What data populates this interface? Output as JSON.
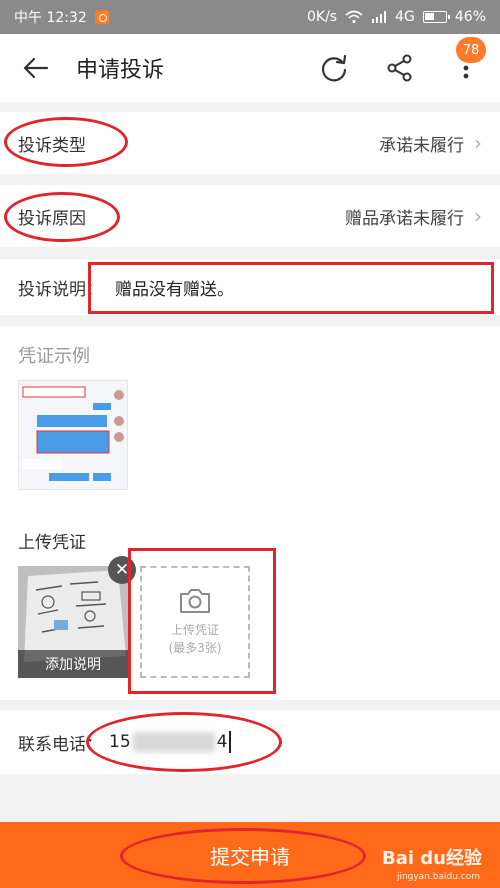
{
  "status_bar": {
    "time": "中午 12:32",
    "net": "0K/s",
    "signal": "4G",
    "battery": "46%"
  },
  "header": {
    "title": "申请投诉",
    "badge": "78"
  },
  "icons": {
    "back": "arrow-left-icon",
    "refresh": "refresh-icon",
    "share": "share-icon",
    "more": "more-vertical-icon",
    "camera": "camera-icon",
    "close": "close-icon",
    "chevron": "chevron-right-icon"
  },
  "complaint_type": {
    "label": "投诉类型",
    "value": "承诺未履行"
  },
  "complaint_reason": {
    "label": "投诉原因",
    "value": "赠品承诺未履行"
  },
  "complaint_desc": {
    "label": "投诉说明：",
    "value": "赠品没有赠送。"
  },
  "evidence": {
    "example_title": "凭证示例",
    "upload_title": "上传凭证",
    "photo_caption": "添加说明",
    "upload_box_line1": "上传凭证",
    "upload_box_line2": "(最多3张)"
  },
  "contact": {
    "label": "联系电话：",
    "value_start": "15",
    "value_end": "4"
  },
  "submit": {
    "label": "提交申请"
  },
  "watermark": {
    "brand": "Bai du经验",
    "url": "jingyan.baidu.com"
  },
  "colors": {
    "accent": "#ff6a1a",
    "annotation": "#e1252a"
  }
}
